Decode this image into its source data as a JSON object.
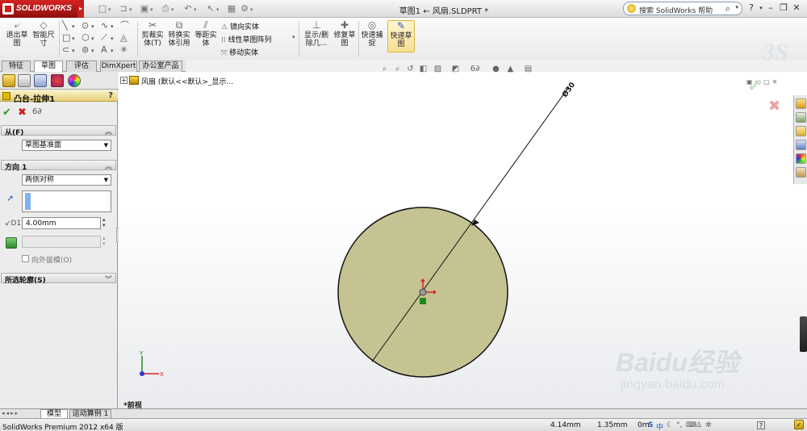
{
  "app": {
    "logo_text": "SOLIDWORKS",
    "document_title": "草图1 ← 风扇.SLDPRT *"
  },
  "search": {
    "placeholder": "搜索 SolidWorks 帮助"
  },
  "toolbar": {
    "exit_sketch": "退出草\n图",
    "smart_dim": "智能尺\n寸",
    "trim": "剪裁实\n体(T)",
    "convert": "转换实\n体引用",
    "offset": "等距实\n体",
    "mirror": "镜向实体",
    "linear_pattern": "线性草图阵列",
    "move": "移动实体",
    "display_delete": "显示/删\n除几...",
    "repair": "修复草\n图",
    "quick_snap": "快速捕\n捉",
    "rapid_sketch": "快速草\n图"
  },
  "tabs": [
    {
      "label": "特征",
      "active": false
    },
    {
      "label": "草图",
      "active": true
    },
    {
      "label": "评估",
      "active": false
    },
    {
      "label": "DimXpert",
      "active": false
    },
    {
      "label": "办公室产品",
      "active": false
    }
  ],
  "property_manager": {
    "title": "凸台-拉伸1",
    "help": "?",
    "from_section": "从(F)",
    "from_value": "草图基准面",
    "direction_section": "方向 1",
    "direction_value": "两侧对称",
    "depth_value": "4.00mm",
    "draft_outward": "向外拔模(O)",
    "selected_contours": "所选轮廓(S)"
  },
  "feature_tree": {
    "root": "风扇 (默认<<默认>_显示..."
  },
  "graphics": {
    "dimension_text": "Ø30",
    "view_label": "*前视",
    "axis_x": "X",
    "axis_y": "Y"
  },
  "bottom_tabs": [
    "模型",
    "运动算例 1"
  ],
  "status": {
    "product": "SolidWorks Premium 2012 x64 版",
    "x_coord": "4.14mm",
    "y_coord": "1.35mm",
    "z_coord": "0mm",
    "help_label": "?"
  },
  "watermark": {
    "text": "Baidu经验",
    "url": "jingyan.baidu.com"
  },
  "colors": {
    "circle_fill": "#c6c392",
    "accent_red": "#c81e1e",
    "confirm_green": "#2e9b2e"
  }
}
